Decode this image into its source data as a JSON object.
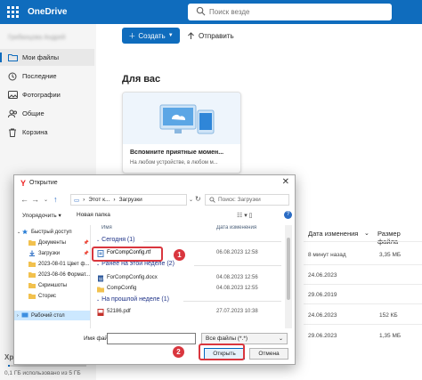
{
  "app": {
    "title": "OneDrive",
    "search_placeholder": "Поиск везде"
  },
  "sidebar": {
    "user": "Грибанцова Андрей",
    "items": [
      {
        "label": "Мои файлы",
        "icon": "folder-icon",
        "active": true
      },
      {
        "label": "Последние",
        "icon": "clock-icon"
      },
      {
        "label": "Фотографии",
        "icon": "photo-icon"
      },
      {
        "label": "Общие",
        "icon": "people-icon"
      },
      {
        "label": "Корзина",
        "icon": "trash-icon"
      }
    ],
    "storage_head": "Хр",
    "storage_text": "0,1 ГБ использовано из 5 ГБ",
    "storage_used_fraction": 0.02
  },
  "toolbar": {
    "create": "Создать",
    "send": "Отправить"
  },
  "main": {
    "for_you": "Для вас",
    "card": {
      "title": "Вспомните приятные момен...",
      "subtitle": "На любом устройстве, в любом м..."
    },
    "columns": {
      "modified": "Дата изменения",
      "size": "Размер файла"
    },
    "rows": [
      {
        "date": "8 минут назад",
        "size": "3,35 МБ"
      },
      {
        "date": "24.06.2023",
        "size": ""
      },
      {
        "date": "29.06.2019",
        "size": ""
      },
      {
        "date": "24.06.2023",
        "size": "152 КБ"
      },
      {
        "date": "29.06.2023",
        "size": "1,35 МБ"
      }
    ]
  },
  "dialog": {
    "title": "Открытие",
    "path_part1": "Этот к...",
    "path_part2": "Загрузки",
    "search_placeholder": "Поиск: Загрузки",
    "organize": "Упорядочить",
    "new_folder": "Новая папка",
    "views": "☷ ▾  ▯",
    "help": "?",
    "tree": [
      {
        "label": "Быстрый доступ",
        "icon": "star-icon",
        "pin": false
      },
      {
        "label": "Документы",
        "icon": "folder-icon",
        "pin": true
      },
      {
        "label": "Загрузки",
        "icon": "download-icon",
        "pin": true
      },
      {
        "label": "2023-08-01 Цвет ф...",
        "icon": "folder-icon",
        "pin": false
      },
      {
        "label": "2023-08-06 Формат...",
        "icon": "folder-icon",
        "pin": false
      },
      {
        "label": "Скриншоты",
        "icon": "folder-icon",
        "pin": false
      },
      {
        "label": "Сторис",
        "icon": "folder-icon",
        "pin": false
      },
      {
        "label": "Рабочий стол",
        "icon": "desktop-icon",
        "pin": false,
        "selected": true
      }
    ],
    "file_columns": {
      "name": "Имя",
      "date": "Дата изменения"
    },
    "groups": [
      {
        "label": "Сегодня (1)"
      },
      {
        "label": "Ранее на этой неделе (2)"
      },
      {
        "label": "На прошлой неделе (1)"
      }
    ],
    "files": [
      {
        "name": "ForCompConfig.rtf",
        "date": "06.08.2023 12:58",
        "icon": "rtf-file-icon"
      },
      {
        "name": "ForCompConfig.docx",
        "date": "04.08.2023 12:56",
        "icon": "word-file-icon"
      },
      {
        "name": "CompConfig",
        "date": "04.08.2023 12:55",
        "icon": "folder-icon"
      },
      {
        "name": "52186.pdf",
        "date": "27.07.2023 10:38",
        "icon": "pdf-file-icon"
      }
    ],
    "filename_label": "Имя файла:",
    "filename_value": "",
    "filter": "Все файлы (*.*)",
    "open": "Открыть",
    "cancel": "Отмена"
  },
  "annotations": {
    "step1": "1",
    "step2": "2"
  },
  "colors": {
    "accent": "#0f6cbd",
    "annotation": "#d9363e"
  }
}
